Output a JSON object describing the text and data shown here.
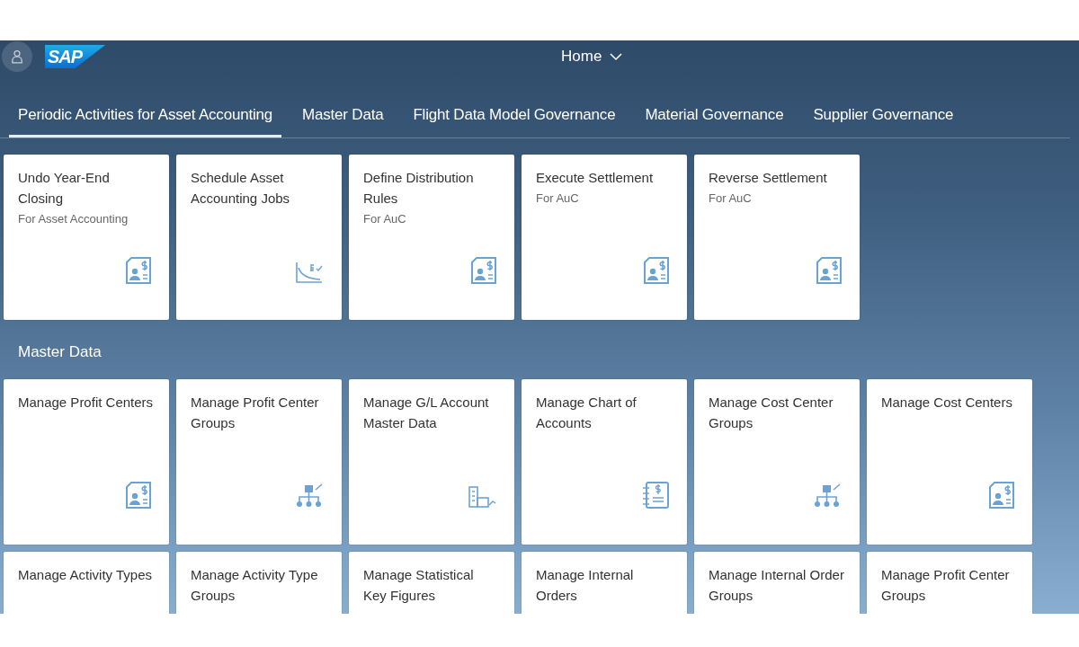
{
  "shell": {
    "logo": "SAP",
    "title": "Home"
  },
  "tabs": [
    {
      "label": "Periodic Activities for Asset Accounting",
      "selected": true
    },
    {
      "label": "Master Data",
      "selected": false
    },
    {
      "label": "Flight Data Model Governance",
      "selected": false
    },
    {
      "label": "Material Governance",
      "selected": false
    },
    {
      "label": "Supplier Governance",
      "selected": false
    }
  ],
  "sections": [
    {
      "tiles": [
        {
          "title": "Undo Year-End Closing",
          "subtitle": "For Asset Accounting"
        },
        {
          "title": "Schedule Asset Accounting Jobs"
        },
        {
          "title": "Define Distribution Rules",
          "subtitle": "For AuC"
        },
        {
          "title": "Execute Settlement",
          "subtitle": "For AuC"
        },
        {
          "title": "Reverse Settlement",
          "subtitle": "For AuC"
        }
      ]
    },
    {
      "title": "Master Data",
      "tiles": [
        {
          "title": "Manage Profit Centers"
        },
        {
          "title": "Manage Profit Center Groups"
        },
        {
          "title": "Manage G/L Account Master Data"
        },
        {
          "title": "Manage Chart of Accounts"
        },
        {
          "title": "Manage Cost Center Groups"
        },
        {
          "title": "Manage Cost Centers"
        },
        {
          "title": "Manage Activity Types"
        },
        {
          "title": "Manage Activity Type Groups"
        },
        {
          "title": "Manage Statistical Key Figures"
        },
        {
          "title": "Manage Internal Orders"
        },
        {
          "title": "Manage Internal Order Groups"
        },
        {
          "title": "Manage Profit Center Groups"
        }
      ]
    }
  ]
}
